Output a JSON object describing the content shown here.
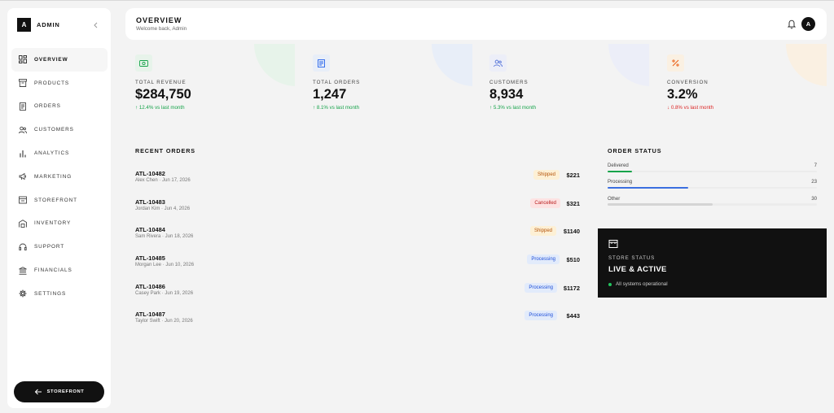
{
  "brand": {
    "logo_letter": "A",
    "name": "ADMIN"
  },
  "sidebar": {
    "items": [
      {
        "label": "OVERVIEW",
        "icon": "grid-icon",
        "active": true
      },
      {
        "label": "PRODUCTS",
        "icon": "box-icon"
      },
      {
        "label": "ORDERS",
        "icon": "receipt-icon"
      },
      {
        "label": "CUSTOMERS",
        "icon": "users-icon"
      },
      {
        "label": "ANALYTICS",
        "icon": "bar-chart-icon"
      },
      {
        "label": "MARKETING",
        "icon": "megaphone-icon"
      },
      {
        "label": "STOREFRONT",
        "icon": "store-icon"
      },
      {
        "label": "INVENTORY",
        "icon": "warehouse-icon"
      },
      {
        "label": "SUPPORT",
        "icon": "headset-icon"
      },
      {
        "label": "FINANCIALS",
        "icon": "bank-icon"
      },
      {
        "label": "SETTINGS",
        "icon": "gear-icon"
      }
    ],
    "storefront_button": "STOREFRONT"
  },
  "header": {
    "title": "OVERVIEW",
    "subtitle": "Welcome back, Admin",
    "avatar_letter": "A"
  },
  "stats": [
    {
      "label": "TOTAL REVENUE",
      "value": "$284,750",
      "delta": "↑ 12.4% vs last month",
      "trend": "up",
      "icon": "cash-icon",
      "accent": "#16a34a",
      "tint": "#e7f3ea"
    },
    {
      "label": "TOTAL ORDERS",
      "value": "1,247",
      "delta": "↑ 8.1% vs last month",
      "trend": "up",
      "icon": "receipt-icon",
      "accent": "#2563eb",
      "tint": "#e8eef8"
    },
    {
      "label": "CUSTOMERS",
      "value": "8,934",
      "delta": "↑ 5.3% vs last month",
      "trend": "up",
      "icon": "users-icon",
      "accent": "#4f6fd8",
      "tint": "#eceef8"
    },
    {
      "label": "CONVERSION",
      "value": "3.2%",
      "delta": "↓ 0.8% vs last month",
      "trend": "down",
      "icon": "percent-icon",
      "accent": "#ea580c",
      "tint": "#faf0e2"
    }
  ],
  "recent_orders": {
    "title": "RECENT ORDERS",
    "rows": [
      {
        "id": "ATL-10482",
        "meta": "Alex Chen · Jun 17, 2026",
        "status": "Shipped",
        "amount": "$221"
      },
      {
        "id": "ATL-10483",
        "meta": "Jordan Kim · Jun 4, 2026",
        "status": "Cancelled",
        "amount": "$321"
      },
      {
        "id": "ATL-10484",
        "meta": "Sam Rivera · Jun 18, 2026",
        "status": "Shipped",
        "amount": "$1140"
      },
      {
        "id": "ATL-10485",
        "meta": "Morgan Lee · Jun 10, 2026",
        "status": "Processing",
        "amount": "$510"
      },
      {
        "id": "ATL-10486",
        "meta": "Casey Park · Jun 19, 2026",
        "status": "Processing",
        "amount": "$1172"
      },
      {
        "id": "ATL-10487",
        "meta": "Taylor Swift · Jun 20, 2026",
        "status": "Processing",
        "amount": "$443"
      }
    ]
  },
  "status_colors": {
    "Shipped": {
      "bg": "#fdf0d5",
      "fg": "#b45309"
    },
    "Cancelled": {
      "bg": "#fde2e2",
      "fg": "#b91c1c"
    },
    "Processing": {
      "bg": "#e2ebfb",
      "fg": "#1d4ed8"
    }
  },
  "order_status": {
    "title": "ORDER STATUS",
    "max": 30,
    "items": [
      {
        "label": "Delivered",
        "count": 7,
        "color": "#16a34a"
      },
      {
        "label": "Processing",
        "count": 23,
        "color": "#3b6fe0"
      },
      {
        "label": "Other",
        "count": 30,
        "color": "#d4d4d4"
      }
    ]
  },
  "store_status": {
    "label": "STORE STATUS",
    "value": "LIVE & ACTIVE",
    "note": "All systems operational",
    "icon": "store-icon"
  }
}
